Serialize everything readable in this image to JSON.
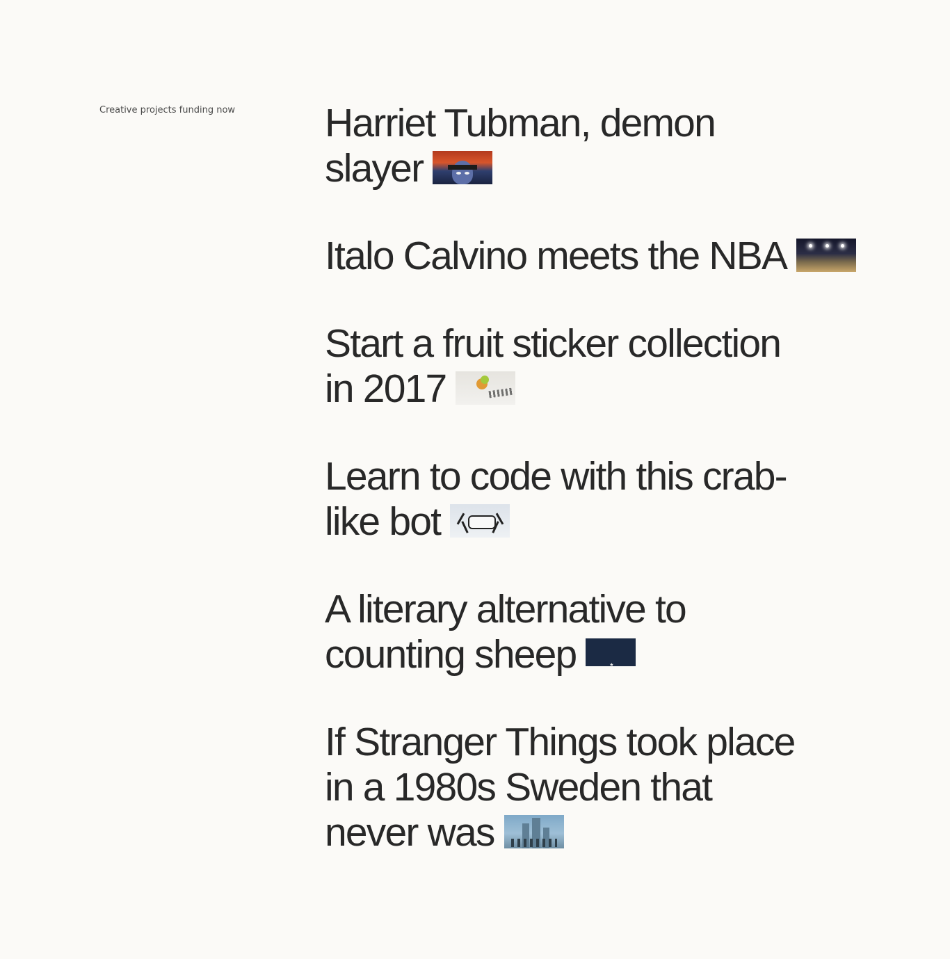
{
  "section_label": "Creative projects funding now",
  "projects": [
    {
      "title": "Harriet Tubman, demon slayer"
    },
    {
      "title": "Italo Calvino meets the NBA"
    },
    {
      "title": "Start a fruit sticker collection in 2017"
    },
    {
      "title": "Learn to code with this crab-like bot"
    },
    {
      "title": "A literary alternative to counting sheep"
    },
    {
      "title": "If Stranger Things took place in a 1980s Sweden that never was"
    }
  ]
}
